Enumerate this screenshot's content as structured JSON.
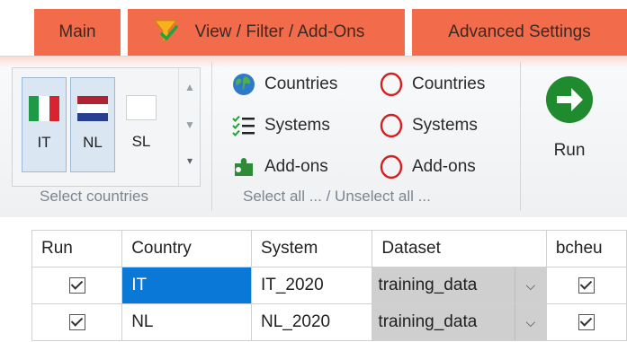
{
  "tabs": {
    "main": "Main",
    "view": "View / Filter / Add-Ons",
    "advanced": "Advanced Settings"
  },
  "countries_group": {
    "items": [
      {
        "code": "IT",
        "selected": true
      },
      {
        "code": "NL",
        "selected": true
      },
      {
        "code": "SL",
        "selected": false
      }
    ],
    "label": "Select countries"
  },
  "select_group": {
    "select_all": [
      "Countries",
      "Systems",
      "Add-ons"
    ],
    "unselect_all": [
      "Countries",
      "Systems",
      "Add-ons"
    ],
    "label": "Select all ... / Unselect all ..."
  },
  "run": {
    "label": "Run"
  },
  "grid": {
    "columns": [
      "Run",
      "Country",
      "System",
      "Dataset",
      "bcheu"
    ],
    "rows": [
      {
        "run": true,
        "country": "IT",
        "system": "IT_2020",
        "dataset": "training_data",
        "bcheu": true
      },
      {
        "run": true,
        "country": "NL",
        "system": "NL_2020",
        "dataset": "training_data",
        "bcheu": true
      }
    ]
  },
  "colors": {
    "tab": "#f26b4b",
    "selection": "#0a78d7",
    "run_icon": "#1f8a2e"
  },
  "icons": [
    "funnel-check-icon",
    "globe-icon",
    "checklist-icon",
    "puzzle-icon",
    "circle-outline-icon",
    "arrow-right-circle-icon"
  ]
}
